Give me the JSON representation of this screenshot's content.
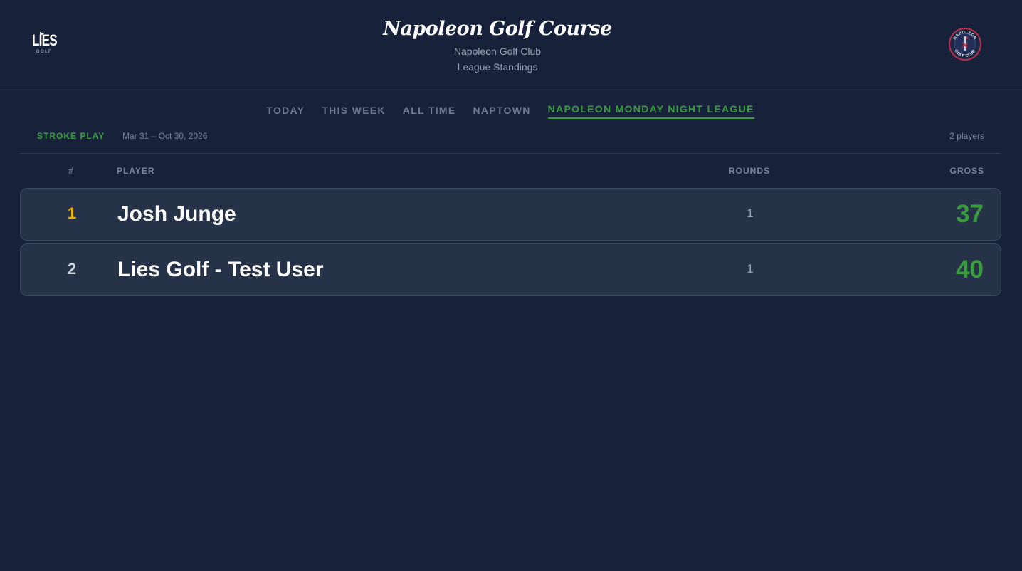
{
  "header": {
    "brand_logo_text": "LIES",
    "brand_logo_sub": "GOLF",
    "course_title": "Napoleon Golf Course",
    "club_name": "Napoleon Golf Club",
    "subtitle": "League Standings",
    "club_badge_text_top": "NAPOLEON",
    "club_badge_text_bottom": "GOLF CLUB",
    "club_badge_monogram": "N"
  },
  "tabs": [
    {
      "label": "TODAY",
      "active": false
    },
    {
      "label": "THIS WEEK",
      "active": false
    },
    {
      "label": "ALL TIME",
      "active": false
    },
    {
      "label": "NAPTOWN",
      "active": false
    },
    {
      "label": "NAPOLEON MONDAY NIGHT LEAGUE",
      "active": true
    }
  ],
  "meta": {
    "format": "STROKE PLAY",
    "date_range": "Mar 31 – Oct 30, 2026",
    "player_count": "2 players"
  },
  "columns": {
    "rank": "#",
    "player": "PLAYER",
    "rounds": "ROUNDS",
    "gross": "GROSS"
  },
  "rows": [
    {
      "rank": "1",
      "player": "Josh Junge",
      "rounds": "1",
      "gross": "37"
    },
    {
      "rank": "2",
      "player": "Lies Golf - Test User",
      "rounds": "1",
      "gross": "40"
    }
  ],
  "colors": {
    "background": "#18213a",
    "accent_green": "#3a9c3e",
    "gold": "#e8b400",
    "row_bg": "#263248"
  }
}
